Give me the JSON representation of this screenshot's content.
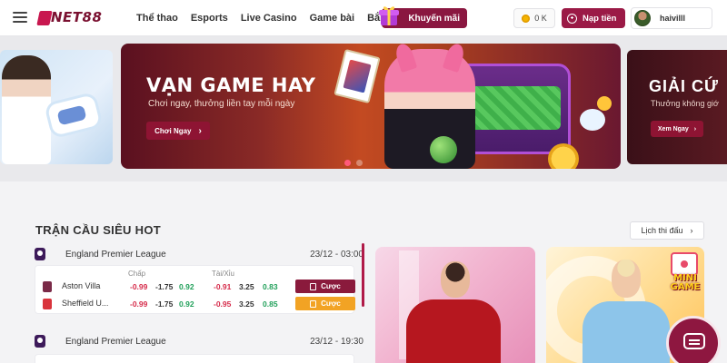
{
  "header": {
    "logo_text": "NET88",
    "nav": [
      "Thể thao",
      "Esports",
      "Live Casino",
      "Game bài",
      "Bắn cá"
    ],
    "promo_label": "Khuyến mãi",
    "balance": "0 K",
    "deposit_label": "Nạp tiền",
    "username": "haivilll"
  },
  "banners": {
    "main": {
      "title": "VẠN GAME HAY",
      "subtitle": "Chơi ngay, thưởng liền tay mỗi ngày",
      "button": "Chơi Ngay"
    },
    "right": {
      "title": "GIẢI CỨ",
      "subtitle": "Thưởng không giớ",
      "button": "Xem Ngay"
    }
  },
  "hot_matches": {
    "title": "TRẬN CẦU SIÊU HOT",
    "schedule_label": "Lịch thi đấu",
    "columns": [
      "Chấp",
      "Tài/Xỉu"
    ],
    "matches": [
      {
        "league": "England Premier League",
        "time": "23/12 - 03:00",
        "teams": [
          {
            "name": "Aston Villa",
            "odds": [
              "-0.99",
              "-1.75",
              "0.92",
              "-0.91",
              "3.25",
              "0.83"
            ],
            "bet": "Cược"
          },
          {
            "name": "Sheffield U...",
            "odds": [
              "-0.99",
              "-1.75",
              "0.92",
              "-0.95",
              "3.25",
              "0.85"
            ],
            "bet": "Cược"
          }
        ]
      },
      {
        "league": "England Premier League",
        "time": "23/12 - 19:30"
      }
    ]
  },
  "mini_game": "MINI GAME",
  "colors": {
    "brand": "#9b1a46",
    "odd_negative": "#d62b4a",
    "odd_positive": "#21a05a",
    "bet_orange": "#f2a324"
  }
}
